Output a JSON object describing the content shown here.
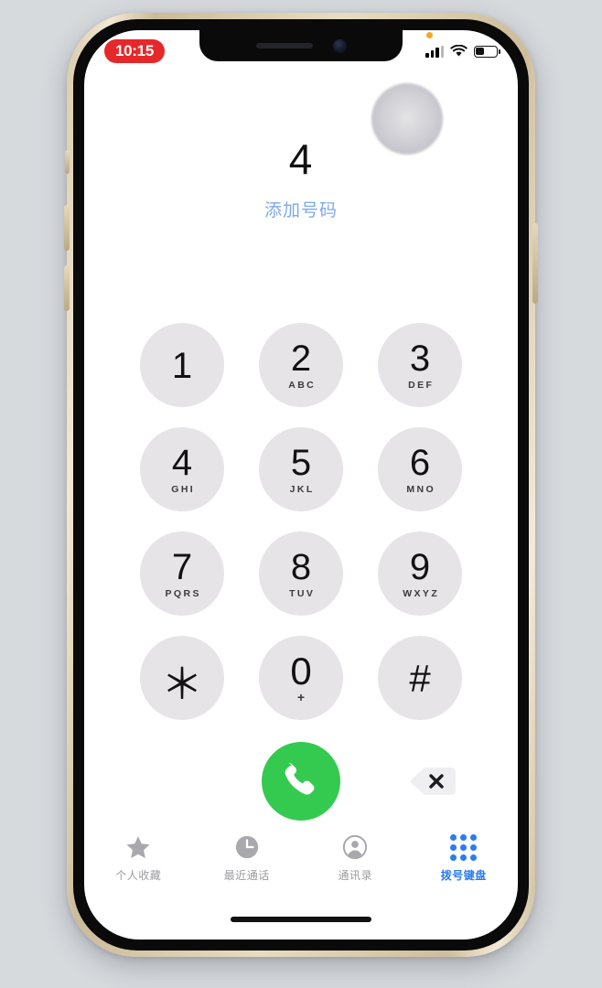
{
  "device": {
    "frame_color": "#e0d3b4",
    "bezel_color": "#0a0a0b",
    "background_color": "#d6dadd"
  },
  "status_bar": {
    "time": "10:15",
    "time_pill_color": "#e7282a",
    "recording_active": true,
    "mic_indicator_color": "#f5a623",
    "signal_icon": "cellular-signal-icon",
    "wifi_icon": "wifi-icon",
    "battery_icon": "battery-icon",
    "battery_level_percent": 38
  },
  "notch": {
    "speaker_icon": "earpiece-speaker-icon",
    "camera_icon": "front-camera-icon"
  },
  "display": {
    "dialed_number": "4",
    "add_number_label": "添加号码",
    "add_number_color": "#7daaea"
  },
  "keypad": {
    "keys": [
      {
        "digit": "1",
        "letters": ""
      },
      {
        "digit": "2",
        "letters": "ABC"
      },
      {
        "digit": "3",
        "letters": "DEF"
      },
      {
        "digit": "4",
        "letters": "GHI"
      },
      {
        "digit": "5",
        "letters": "JKL"
      },
      {
        "digit": "6",
        "letters": "MNO"
      },
      {
        "digit": "7",
        "letters": "PQRS"
      },
      {
        "digit": "8",
        "letters": "TUV"
      },
      {
        "digit": "9",
        "letters": "WXYZ"
      },
      {
        "digit": "＊",
        "letters": ""
      },
      {
        "digit": "0",
        "letters": "+"
      },
      {
        "digit": "#",
        "letters": ""
      }
    ],
    "key_background_color": "#e6e4e7"
  },
  "actions": {
    "call_button_icon": "phone-handset-icon",
    "call_button_color": "#34ca50",
    "backspace_icon": "backspace-delete-icon"
  },
  "tab_bar": {
    "active_color": "#2b7bf3",
    "inactive_color": "#9b9b9f",
    "tabs": [
      {
        "label": "个人收藏",
        "icon": "star-icon",
        "active": false
      },
      {
        "label": "最近通话",
        "icon": "clock-icon",
        "active": false
      },
      {
        "label": "通讯录",
        "icon": "person-circle-icon",
        "active": false
      },
      {
        "label": "拨号键盘",
        "icon": "keypad-dots-icon",
        "active": true
      }
    ]
  },
  "home_indicator": {
    "visible": true
  }
}
